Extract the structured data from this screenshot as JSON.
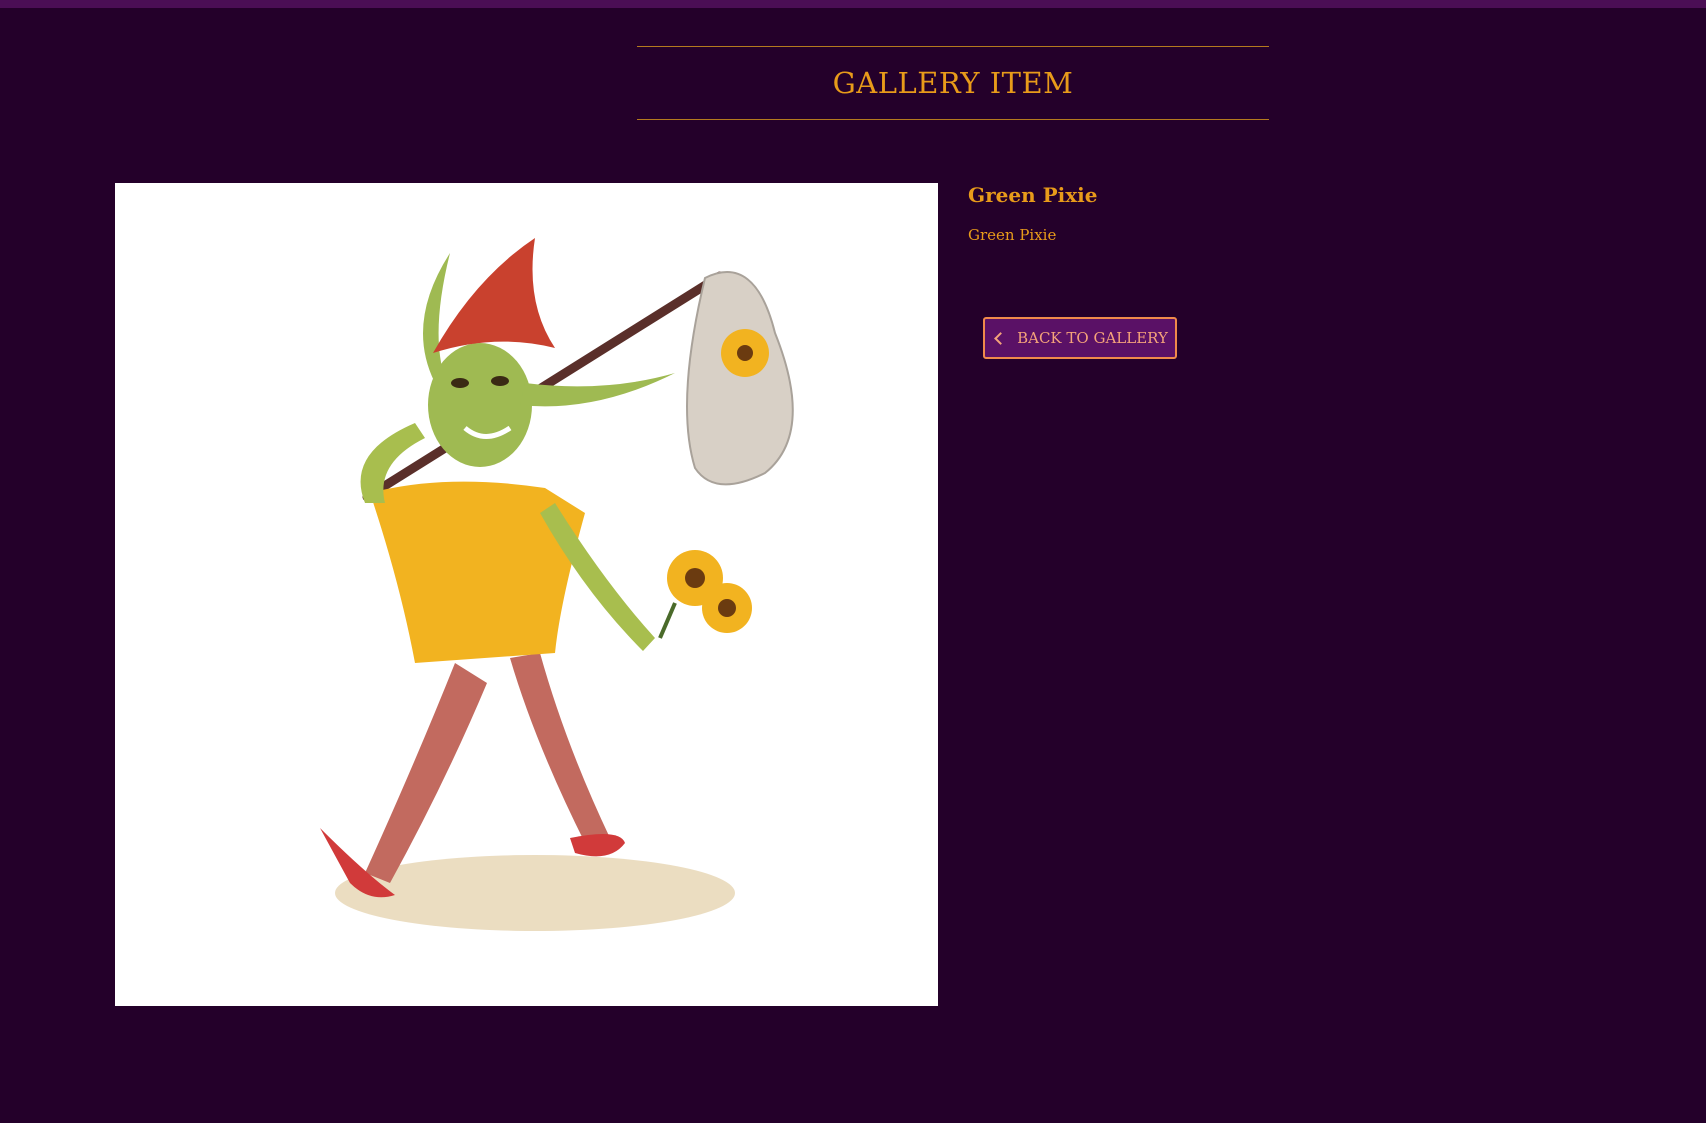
{
  "header": {
    "title": "GALLERY ITEM"
  },
  "item": {
    "title": "Green Pixie",
    "description": "Green Pixie",
    "image_alt": "Green Pixie"
  },
  "actions": {
    "back_label": "BACK TO GALLERY",
    "back_icon": "chevron-left-icon"
  },
  "colors": {
    "background": "#24002a",
    "top_bar": "#4b0e55",
    "accent_gold": "#e89b1a",
    "button_fill": "#5a1166",
    "button_border": "#f08a4b"
  }
}
